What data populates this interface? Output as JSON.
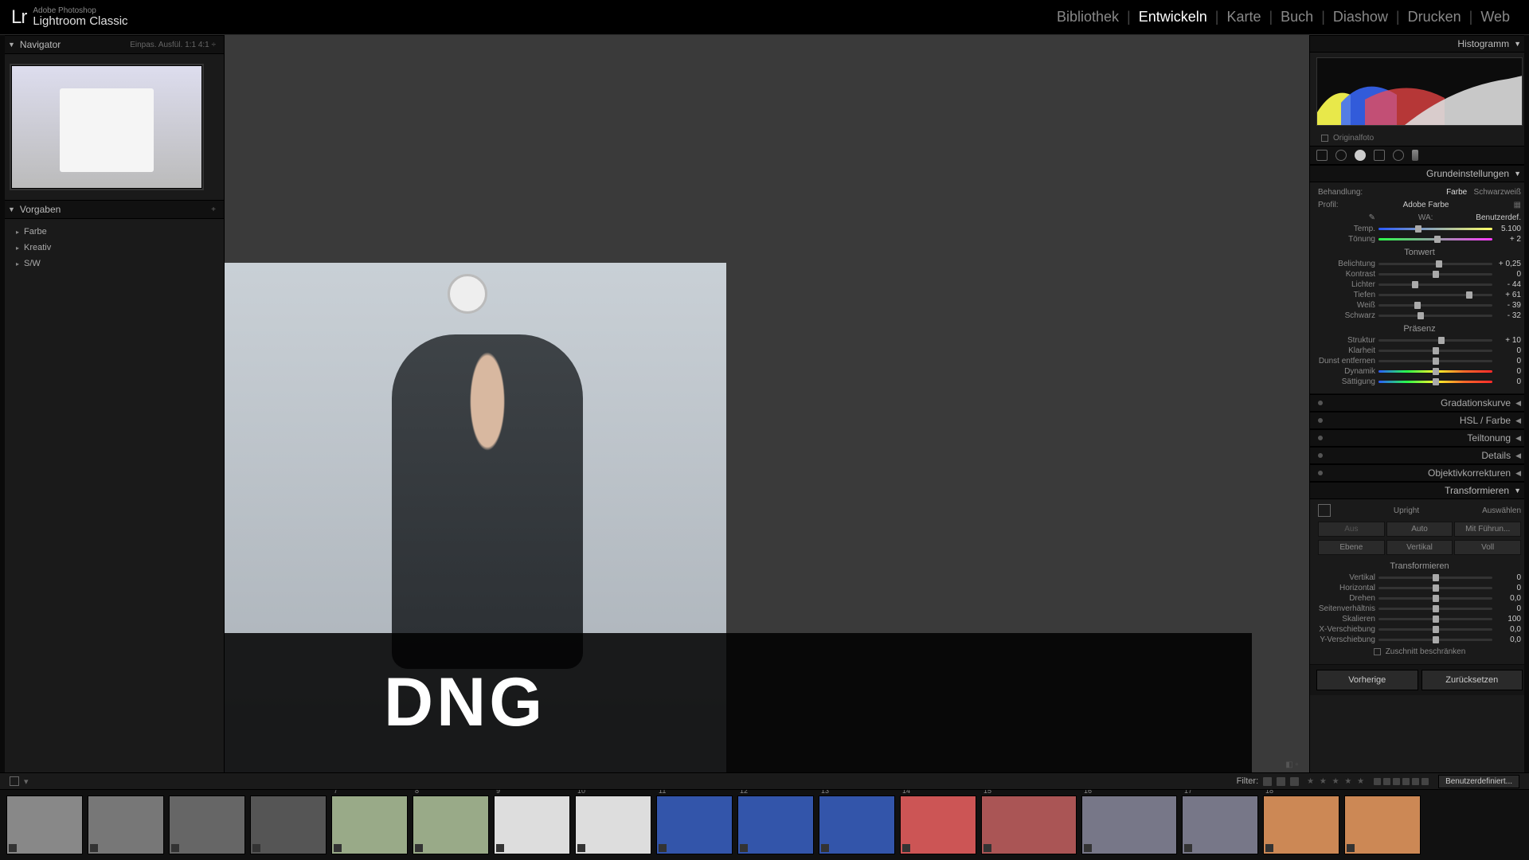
{
  "app": {
    "vendor": "Adobe Photoshop",
    "product": "Lightroom Classic"
  },
  "modules": {
    "items": [
      "Bibliothek",
      "Entwickeln",
      "Karte",
      "Buch",
      "Diashow",
      "Drucken",
      "Web"
    ],
    "active_index": 1
  },
  "left": {
    "navigator": {
      "title": "Navigator",
      "extras": "Einpas.   Ausfül.   1:1   4:1  ÷"
    },
    "presets": {
      "title": "Vorgaben",
      "items": [
        "Farbe",
        "Kreativ",
        "S/W"
      ]
    }
  },
  "overlay": {
    "title": "DNG"
  },
  "right": {
    "histogram_title": "Histogramm",
    "original_foto": "Originalfoto",
    "basic": {
      "title": "Grundeinstellungen",
      "treatment_label": "Behandlung:",
      "treatment_color": "Farbe",
      "treatment_bw": "Schwarzweiß",
      "profile_label": "Profil:",
      "profile_value": "Adobe Farbe",
      "wb_label": "WA:",
      "wb_value": "Benutzerdef.",
      "tonwert": "Tonwert",
      "praesenz": "Präsenz",
      "sliders": {
        "temp": {
          "label": "Temp.",
          "value": "5.100",
          "pos": 35
        },
        "tint": {
          "label": "Tönung",
          "value": "+ 2",
          "pos": 52
        },
        "exposure": {
          "label": "Belichtung",
          "value": "+ 0,25",
          "pos": 53
        },
        "contrast": {
          "label": "Kontrast",
          "value": "0",
          "pos": 50
        },
        "highlights": {
          "label": "Lichter",
          "value": "- 44",
          "pos": 32
        },
        "shadows": {
          "label": "Tiefen",
          "value": "+ 61",
          "pos": 80
        },
        "whites": {
          "label": "Weiß",
          "value": "- 39",
          "pos": 34
        },
        "blacks": {
          "label": "Schwarz",
          "value": "- 32",
          "pos": 37
        },
        "texture": {
          "label": "Struktur",
          "value": "+ 10",
          "pos": 55
        },
        "clarity": {
          "label": "Klarheit",
          "value": "0",
          "pos": 50
        },
        "dehaze": {
          "label": "Dunst entfernen",
          "value": "0",
          "pos": 50
        },
        "vibrance": {
          "label": "Dynamik",
          "value": "0",
          "pos": 50
        },
        "saturation": {
          "label": "Sättigung",
          "value": "0",
          "pos": 50
        }
      }
    },
    "collapsed": [
      "Gradationskurve",
      "HSL / Farbe",
      "Teiltonung",
      "Details",
      "Objektivkorrekturen"
    ],
    "transform": {
      "title": "Transformieren",
      "upright": "Upright",
      "auswaehlen": "Auswählen",
      "buttons_row1": [
        "Aus",
        "Auto",
        "Mit Führun..."
      ],
      "buttons_row2": [
        "Ebene",
        "Vertikal",
        "Voll"
      ],
      "section": "Transformieren",
      "sliders": {
        "vertical": {
          "label": "Vertikal",
          "value": "0",
          "pos": 50
        },
        "horizontal": {
          "label": "Horizontal",
          "value": "0",
          "pos": 50
        },
        "rotate": {
          "label": "Drehen",
          "value": "0,0",
          "pos": 50
        },
        "aspect": {
          "label": "Seitenverhältnis",
          "value": "0",
          "pos": 50
        },
        "scale": {
          "label": "Skalieren",
          "value": "100",
          "pos": 50
        },
        "xoffset": {
          "label": "X-Verschiebung",
          "value": "0,0",
          "pos": 50
        },
        "yoffset": {
          "label": "Y-Verschiebung",
          "value": "0,0",
          "pos": 50
        }
      },
      "constrain": "Zuschnitt beschränken"
    },
    "bottom": {
      "previous": "Vorherige",
      "reset": "Zurücksetzen"
    }
  },
  "filter": {
    "label": "Filter:",
    "custom": "Benutzerdefiniert..."
  },
  "filmstrip": {
    "thumbs": [
      {
        "num": ""
      },
      {
        "num": ""
      },
      {
        "num": ""
      },
      {
        "num": ""
      },
      {
        "num": "7"
      },
      {
        "num": "8"
      },
      {
        "num": "9"
      },
      {
        "num": "10"
      },
      {
        "num": "11"
      },
      {
        "num": "12"
      },
      {
        "num": "13"
      },
      {
        "num": "14"
      },
      {
        "num": "15"
      },
      {
        "num": "16"
      },
      {
        "num": "17"
      },
      {
        "num": "18"
      },
      {
        "num": ""
      }
    ]
  }
}
